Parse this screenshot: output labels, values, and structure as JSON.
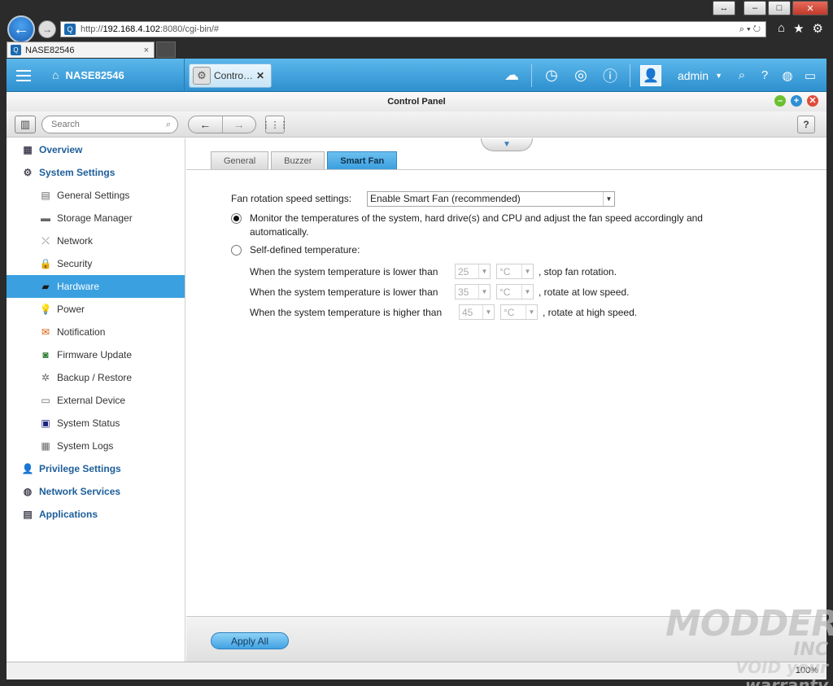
{
  "browser": {
    "url_prefix": "http://",
    "url_host": "192.168.4.102",
    "url_rest": ":8080/cgi-bin/#",
    "tab_title": "NASE82546",
    "tab_close": "×",
    "url_tools": "⌕ ▾ ↻",
    "fav_letter": "Q",
    "zoom_label": "100%",
    "window_buttons": {
      "resize": "↔",
      "minimize": "–",
      "maximize": "□",
      "close": "✕"
    },
    "back": "←",
    "forward": "→"
  },
  "topbar": {
    "device_name": "NASE82546",
    "app_tab_label": "Contro…",
    "app_tab_close": "✕",
    "user": "admin",
    "user_caret": "▼"
  },
  "window": {
    "title": "Control Panel",
    "min": "–",
    "max": "+",
    "close": "✕"
  },
  "toolbar": {
    "search_placeholder": "Search",
    "back": "←",
    "forward": "→",
    "apps": "⋮⋮⋮",
    "help": "?"
  },
  "sidebar": {
    "overview": "Overview",
    "system_settings": "System Settings",
    "items": [
      "General Settings",
      "Storage Manager",
      "Network",
      "Security",
      "Hardware",
      "Power",
      "Notification",
      "Firmware Update",
      "Backup / Restore",
      "External Device",
      "System Status",
      "System Logs"
    ],
    "privilege_settings": "Privilege Settings",
    "network_services": "Network Services",
    "applications": "Applications"
  },
  "tabs": [
    "General",
    "Buzzer",
    "Smart Fan"
  ],
  "smartfan": {
    "speed_label": "Fan rotation speed settings:",
    "speed_value": "Enable Smart Fan (recommended)",
    "option_monitor_line1": "Monitor the temperatures of the system, hard drive(s) and CPU and adjust the fan speed accordingly and",
    "option_monitor_line2": "automatically.",
    "option_self": "Self-defined temperature:",
    "rule1_text": "When the system temperature is lower than",
    "rule1_value": "25",
    "rule1_unit": "°C",
    "rule1_action": ", stop fan rotation.",
    "rule2_text": "When the system temperature is lower than",
    "rule2_value": "35",
    "rule2_unit": "°C",
    "rule2_action": ", rotate at low speed.",
    "rule3_text": "When the system temperature is higher than",
    "rule3_value": "45",
    "rule3_unit": "°C",
    "rule3_action": ", rotate at high speed."
  },
  "footer": {
    "apply_all": "Apply All"
  },
  "watermark": {
    "brand": "MODDERS",
    "inc": "INC",
    "tagline": "VOID your warranty"
  }
}
